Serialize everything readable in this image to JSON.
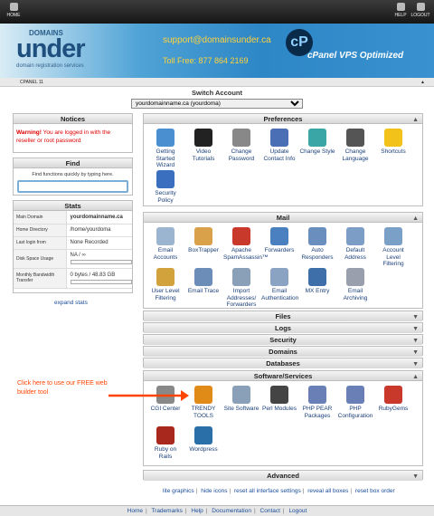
{
  "topbar": {
    "home": "HOME",
    "help": "HELP",
    "logout": "LOGOUT"
  },
  "banner": {
    "logo_top": "DOMAINS",
    "logo_main": "under",
    "logo_sub": "domain registration services",
    "support": "support@domainsunder.ca",
    "tollfree": "Toll Free: 877 864 2169",
    "cpanel_text": "cPanel VPS Optimized"
  },
  "crumb": "CPANEL 11",
  "switch": {
    "heading": "Switch Account",
    "selected": "yourdomainname.ca (yourdoma)"
  },
  "notices": {
    "title": "Notices",
    "warning_label": "Warning!",
    "warning_text": " You are logged in with the reseller or root password"
  },
  "find": {
    "title": "Find",
    "hint": "Find functions quickly by typing here.",
    "placeholder": ""
  },
  "stats": {
    "title": "Stats",
    "rows": [
      {
        "k": "Main Domain",
        "v": "yourdomainname.ca"
      },
      {
        "k": "Home Directory",
        "v": "/home/yourdoma"
      },
      {
        "k": "Last login from",
        "v": "None Recorded"
      },
      {
        "k": "Disk Space Usage",
        "v": "NA / ∞"
      },
      {
        "k": "Monthly Bandwidth Transfer",
        "v": "0 bytes / 48.83 GB"
      }
    ],
    "expand": "expand stats"
  },
  "sections": {
    "preferences": "Preferences",
    "mail": "Mail",
    "files": "Files",
    "logs": "Logs",
    "security": "Security",
    "domains": "Domains",
    "databases": "Databases",
    "software": "Software/Services",
    "advanced": "Advanced"
  },
  "pref_items": [
    {
      "l": "Getting Started Wizard",
      "icon": "wizard-icon",
      "c": "#4a8fd0"
    },
    {
      "l": "Video Tutorials",
      "icon": "clapper-icon",
      "c": "#222"
    },
    {
      "l": "Change Password",
      "icon": "password-icon",
      "c": "#888"
    },
    {
      "l": "Update Contact Info",
      "icon": "contact-icon",
      "c": "#4a6fb5"
    },
    {
      "l": "Change Style",
      "icon": "style-icon",
      "c": "#3aa6a6"
    },
    {
      "l": "Change Language",
      "icon": "language-icon",
      "c": "#555"
    },
    {
      "l": "Shortcuts",
      "icon": "star-icon",
      "c": "#f2c21a"
    },
    {
      "l": "Security Policy",
      "icon": "policy-icon",
      "c": "#3a6fc0"
    }
  ],
  "mail_items": [
    {
      "l": "Email Accounts",
      "icon": "envelope-icon",
      "c": "#9bb4cf"
    },
    {
      "l": "BoxTrapper",
      "icon": "boxtrapper-icon",
      "c": "#d9a14a"
    },
    {
      "l": "Apache SpamAssassin™",
      "icon": "spamassassin-icon",
      "c": "#c8392b"
    },
    {
      "l": "Forwarders",
      "icon": "forwarders-icon",
      "c": "#4a7fc0"
    },
    {
      "l": "Auto Responders",
      "icon": "autoresponder-icon",
      "c": "#6a8fbf"
    },
    {
      "l": "Default Address",
      "icon": "default-address-icon",
      "c": "#7c9ec6"
    },
    {
      "l": "Account Level Filtering",
      "icon": "filter-icon",
      "c": "#7aa0c8"
    },
    {
      "l": "User Level Filtering",
      "icon": "user-filter-icon",
      "c": "#d2a23c"
    },
    {
      "l": "Email Trace",
      "icon": "trace-icon",
      "c": "#6c8db8"
    },
    {
      "l": "Import Addresses/ Forwarders",
      "icon": "import-icon",
      "c": "#8a9fb8"
    },
    {
      "l": "Email Authentication",
      "icon": "auth-icon",
      "c": "#8aa3c2"
    },
    {
      "l": "MX Entry",
      "icon": "mx-icon",
      "c": "#3e6fa8"
    },
    {
      "l": "Email Archiving",
      "icon": "archive-icon",
      "c": "#9a9fae"
    }
  ],
  "software_items": [
    {
      "l": "CGI Center",
      "icon": "cgi-icon",
      "c": "#888"
    },
    {
      "l": "TRENDY TOOLS",
      "icon": "trendy-tools-icon",
      "c": "#e08a18"
    },
    {
      "l": "Site Software",
      "icon": "site-software-icon",
      "c": "#8aa0b8"
    },
    {
      "l": "Perl Modules",
      "icon": "camel-icon",
      "c": "#444"
    },
    {
      "l": "PHP PEAR Packages",
      "icon": "php-pear-icon",
      "c": "#6a7fb5"
    },
    {
      "l": "PHP Configuration",
      "icon": "php-config-icon",
      "c": "#6a7fb5"
    },
    {
      "l": "RubyGems",
      "icon": "rubygems-icon",
      "c": "#c8392b"
    },
    {
      "l": "Ruby on Rails",
      "icon": "rails-icon",
      "c": "#a8281e"
    },
    {
      "l": "Wordpress",
      "icon": "wordpress-icon",
      "c": "#2a6fa8"
    }
  ],
  "hint": "Click here to use our FREE web builder tool",
  "links": [
    "lite graphics",
    "hide icons",
    "reset all interface settings",
    "reveal all boxes",
    "reset box order"
  ],
  "footer": [
    "Home",
    "Trademarks",
    "Help",
    "Documentation",
    "Contact",
    "Logout"
  ]
}
